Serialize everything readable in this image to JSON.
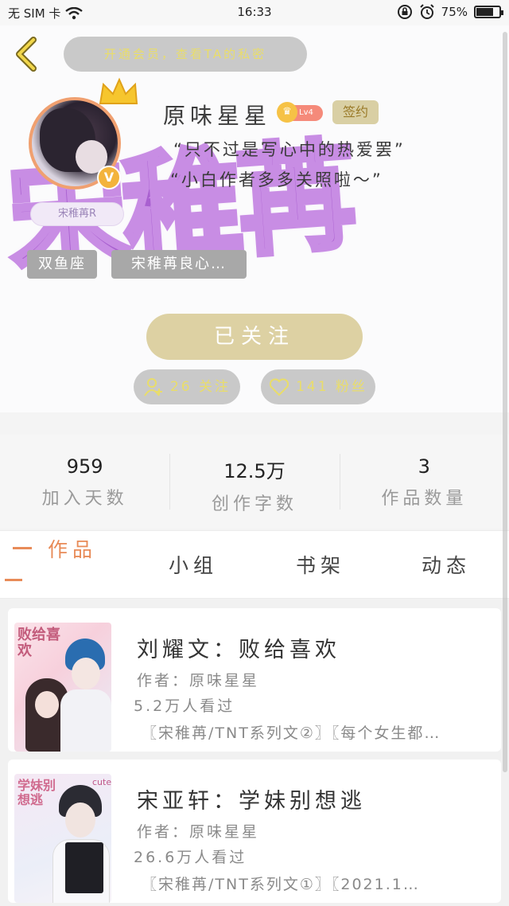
{
  "status_bar": {
    "carrier": "无 SIM 卡",
    "time": "16:33",
    "battery": "75%",
    "battery_level": 0.75
  },
  "header": {
    "notice": "开通会员，查看TA的私密",
    "banner_art": "宋稚苒",
    "username": "原味星星",
    "level": "Lv4",
    "signed_label": "签约",
    "motto_1": "“只不过是写心中的热爱罢”",
    "motto_2": "“小白作者多多关照啦～”",
    "nameplate": "宋稚苒R",
    "vip_mark": "V",
    "tags": [
      "双鱼座",
      "宋稚苒良心…"
    ],
    "follow_button": "已关注",
    "following_count": "26 关注",
    "fans_count": "141 粉丝"
  },
  "stats": [
    {
      "value": "959",
      "label": "加入天数"
    },
    {
      "value": "12.5万",
      "label": "创作字数"
    },
    {
      "value": "3",
      "label": "作品数量"
    }
  ],
  "tabs": [
    "作品",
    "小组",
    "书架",
    "动态"
  ],
  "works": [
    {
      "title": "刘耀文：败给喜欢",
      "author": "作者：原味星星",
      "views": "5.2万人看过",
      "tags": "〖宋稚苒/TNT系列文②〗〖每个女生都…",
      "cover_text": "败给喜欢"
    },
    {
      "title": "宋亚轩：学妹别想逃",
      "author": "作者：原味星星",
      "views": "26.6万人看过",
      "tags": "〖宋稚苒/TNT系列文①〗〖2021.1…",
      "cover_text": "学妹别想逃",
      "cover_badge": "cute"
    }
  ],
  "colors": {
    "accent": "#e88b58",
    "follow_button": "#ddd1a3",
    "banner_purple": "#9b46c9",
    "pill_text": "#e9dd6a"
  }
}
